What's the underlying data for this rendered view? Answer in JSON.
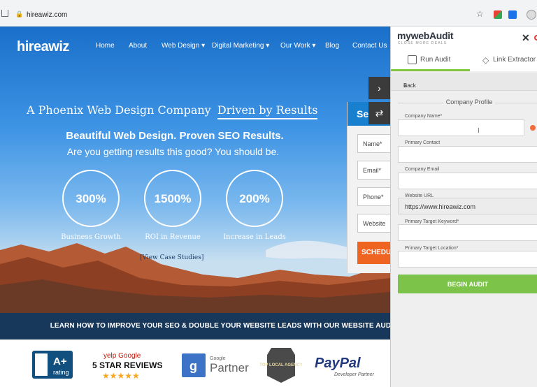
{
  "browser": {
    "url": "hireawiz.com"
  },
  "site": {
    "logo": "hireawiz",
    "nav": [
      "Home",
      "About",
      "Web Design",
      "Digital Marketing",
      "Our Work",
      "Blog",
      "Contact Us"
    ],
    "headline_prefix": "A Phoenix Web Design Company",
    "headline_highlight": "Driven by Results",
    "subheadline": "Beautiful Web Design. Proven SEO Results.",
    "tagline": "Are you getting results this good? You should be.",
    "stats": [
      {
        "value": "300%",
        "label": "Business Growth"
      },
      {
        "value": "1500%",
        "label": "ROI in Revenue"
      },
      {
        "value": "200%",
        "label": "Increase in Leads"
      }
    ],
    "case_link": "[View Case Studies]",
    "form": {
      "heading": "Se",
      "fields": [
        "Name*",
        "Email*",
        "Phone*",
        "Website"
      ],
      "button": "SCHEDU"
    },
    "banner": "LEARN HOW TO IMPROVE YOUR SEO & DOUBLE YOUR WEBSITE LEADS WITH OUR WEBSITE AUDIT",
    "badges": {
      "bbb": "A+",
      "bbb_sub": "rating",
      "yelp_line": "yelp Google",
      "reviews": "5 STAR REVIEWS",
      "stars": "★★★★★",
      "google_small": "Google",
      "partner": "Partner",
      "agency_text": "TOP LOCAL AGENCY",
      "paypal": "PayPal",
      "paypal_sub": "Developer Partner"
    }
  },
  "panel": {
    "logo": "mywebAudit",
    "tagline": "CLOSE MORE DEALS",
    "tabs": [
      "Run Audit",
      "Link Extractor"
    ],
    "back": "Back",
    "section": "Company Profile",
    "fields": [
      {
        "label": "Company Name*",
        "value": ""
      },
      {
        "label": "Primary Contact",
        "value": ""
      },
      {
        "label": "Company Email",
        "value": ""
      },
      {
        "label": "Website URL",
        "value": "https://www.hireawiz.com"
      },
      {
        "label": "Primary Target Keyword*",
        "value": ""
      },
      {
        "label": "Primary Target Location*",
        "value": ""
      }
    ],
    "button": "BEGIN AUDIT"
  }
}
